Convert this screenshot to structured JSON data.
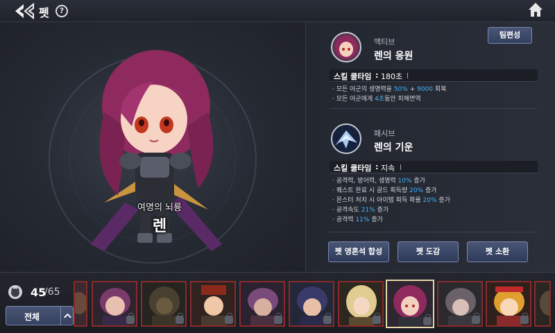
{
  "header": {
    "title": "펫",
    "help_glyph": "?",
    "back_icon": "back-arrow-icon",
    "home_icon": "home-icon"
  },
  "pet": {
    "subtitle": "여명의 뇌룡",
    "name": "렌"
  },
  "team_button": "팀편성",
  "active_skill": {
    "type": "액티브",
    "name": "렌의 응원",
    "cool_label": "스킬 쿨타임",
    "cool_value": "180초",
    "desc": [
      {
        "pre": "· 모든 아군의 생명력을 ",
        "hl1": "50%",
        "mid": " + ",
        "hl2": "9000",
        "post": " 회복"
      },
      {
        "pre": "· 모든 아군에게 ",
        "hl1": "4초",
        "mid": "동안 피해면역",
        "hl2": "",
        "post": ""
      }
    ]
  },
  "passive_skill": {
    "type": "패시브",
    "name": "렌의 기운",
    "cool_label": "스킬 쿨타임",
    "cool_value": "지속",
    "desc": [
      {
        "pre": "· 공격력, 방어력, 생명력 ",
        "hl": "10%",
        "post": " 증가"
      },
      {
        "pre": "· 퀘스트 완료 시 골드 획득량 ",
        "hl": "20%",
        "post": " 증가"
      },
      {
        "pre": "· 몬스터 처치 시 아이템 획득 확률 ",
        "hl": "20%",
        "post": " 증가"
      },
      {
        "pre": "· 공격속도 ",
        "hl": "21%",
        "post": " 증가"
      },
      {
        "pre": "· 공격력 ",
        "hl": "11%",
        "post": " 증가"
      }
    ]
  },
  "actions": {
    "fuse": "펫 영혼석 합성",
    "codex": "펫 도감",
    "summon": "펫 소환"
  },
  "inventory": {
    "count": "45",
    "max": "/65",
    "filter": "전체"
  },
  "colors": {
    "highlight": "#3fb4ff",
    "button": "#3a4668",
    "slot_border": "#8a2a2a",
    "selected_border": "#e8d7a8"
  }
}
